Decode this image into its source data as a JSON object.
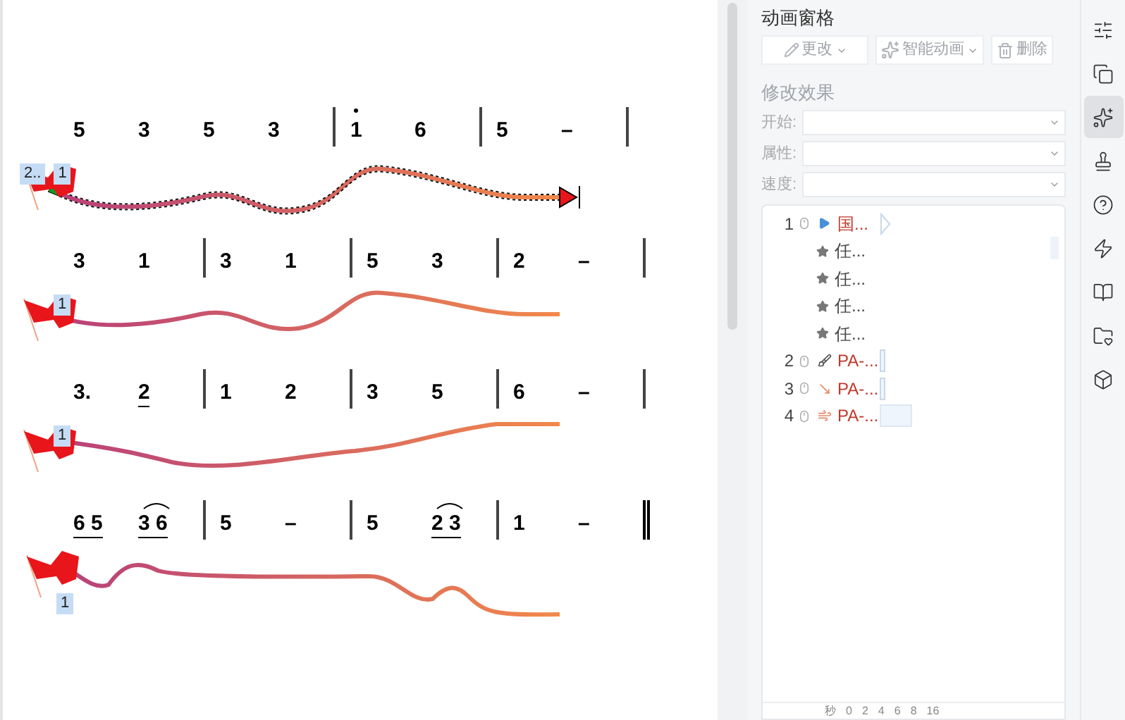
{
  "score": {
    "rows": [
      {
        "selected": true,
        "badges": [
          "2..",
          "1"
        ],
        "measures": [
          {
            "double_bar": false,
            "beats": [
              {
                "text": "5",
                "high": false,
                "underline": false,
                "tie": false
              },
              {
                "text": "3",
                "high": false,
                "underline": false,
                "tie": false
              },
              {
                "text": "5",
                "high": false,
                "underline": false,
                "tie": false
              },
              {
                "text": "3",
                "high": false,
                "underline": false,
                "tie": false
              }
            ]
          },
          {
            "double_bar": false,
            "beats": [
              {
                "text": "1",
                "high": true,
                "underline": false,
                "tie": false
              },
              {
                "text": "6",
                "high": false,
                "underline": false,
                "tie": false
              }
            ]
          },
          {
            "double_bar": false,
            "beats": [
              {
                "text": "5",
                "high": false,
                "underline": false,
                "tie": false
              },
              {
                "text": "–",
                "high": false,
                "underline": false,
                "tie": false
              }
            ]
          }
        ]
      },
      {
        "selected": false,
        "badges": [
          "1"
        ],
        "measures": [
          {
            "double_bar": false,
            "beats": [
              {
                "text": "3",
                "high": false,
                "underline": false,
                "tie": false
              },
              {
                "text": "1",
                "high": false,
                "underline": false,
                "tie": false
              }
            ]
          },
          {
            "double_bar": false,
            "beats": [
              {
                "text": "3",
                "high": false,
                "underline": false,
                "tie": false
              },
              {
                "text": "1",
                "high": false,
                "underline": false,
                "tie": false
              }
            ]
          },
          {
            "double_bar": false,
            "beats": [
              {
                "text": "5",
                "high": false,
                "underline": false,
                "tie": false
              },
              {
                "text": "3",
                "high": false,
                "underline": false,
                "tie": false
              }
            ]
          },
          {
            "double_bar": false,
            "beats": [
              {
                "text": "2",
                "high": false,
                "underline": false,
                "tie": false
              },
              {
                "text": "–",
                "high": false,
                "underline": false,
                "tie": false
              }
            ]
          }
        ]
      },
      {
        "selected": false,
        "badges": [
          "1"
        ],
        "measures": [
          {
            "double_bar": false,
            "beats": [
              {
                "text": "3.",
                "high": false,
                "underline": false,
                "tie": false
              },
              {
                "text": "2",
                "high": false,
                "underline": true,
                "tie": false
              }
            ]
          },
          {
            "double_bar": false,
            "beats": [
              {
                "text": "1",
                "high": false,
                "underline": false,
                "tie": false
              },
              {
                "text": "2",
                "high": false,
                "underline": false,
                "tie": false
              }
            ]
          },
          {
            "double_bar": false,
            "beats": [
              {
                "text": "3",
                "high": false,
                "underline": false,
                "tie": false
              },
              {
                "text": "5",
                "high": false,
                "underline": false,
                "tie": false
              }
            ]
          },
          {
            "double_bar": false,
            "beats": [
              {
                "text": "6",
                "high": false,
                "underline": false,
                "tie": false
              },
              {
                "text": "–",
                "high": false,
                "underline": false,
                "tie": false
              }
            ]
          }
        ]
      },
      {
        "selected": false,
        "badges": [
          "1"
        ],
        "measures": [
          {
            "double_bar": false,
            "beats": [
              {
                "text": "6 5",
                "high": false,
                "underline": true,
                "tie": false
              },
              {
                "text": "3 6",
                "high": false,
                "underline": true,
                "tie": true
              }
            ]
          },
          {
            "double_bar": false,
            "beats": [
              {
                "text": "5",
                "high": false,
                "underline": false,
                "tie": false
              },
              {
                "text": "–",
                "high": false,
                "underline": false,
                "tie": false
              }
            ]
          },
          {
            "double_bar": false,
            "beats": [
              {
                "text": "5",
                "high": false,
                "underline": false,
                "tie": false
              },
              {
                "text": "2 3",
                "high": false,
                "underline": true,
                "tie": true
              }
            ]
          },
          {
            "double_bar": true,
            "beats": [
              {
                "text": "1",
                "high": false,
                "underline": false,
                "tie": false
              },
              {
                "text": "–",
                "high": false,
                "underline": false,
                "tie": false
              }
            ]
          }
        ]
      }
    ]
  },
  "panel": {
    "title": "动画窗格",
    "buttons": [
      {
        "kind": "edit",
        "label": "更改"
      },
      {
        "kind": "smart",
        "label": "智能动画"
      },
      {
        "kind": "delete",
        "label": "删除"
      }
    ],
    "section": "修改效果",
    "fields": [
      {
        "label": "开始:"
      },
      {
        "label": "属性:"
      },
      {
        "label": "速度:"
      }
    ],
    "animations": [
      {
        "number": "1",
        "kind": "play",
        "label": "国...",
        "children": [
          {
            "label": "任..."
          },
          {
            "label": "任..."
          },
          {
            "label": "任..."
          },
          {
            "label": "任..."
          }
        ]
      },
      {
        "number": "2",
        "kind": "brush",
        "label": "PA-..."
      },
      {
        "number": "3",
        "kind": "arrow",
        "label": "PA-..."
      },
      {
        "number": "4",
        "kind": "swirl",
        "label": "PA-..."
      }
    ],
    "ruler": [
      "秒",
      "0",
      "2",
      "4",
      "6",
      "8",
      "16"
    ]
  },
  "sidebar": [
    {
      "kind": "sliders",
      "selected": false
    },
    {
      "kind": "copy",
      "selected": false
    },
    {
      "kind": "star",
      "selected": true
    },
    {
      "kind": "badge",
      "selected": false
    },
    {
      "kind": "help",
      "selected": false
    },
    {
      "kind": "bolt",
      "selected": false
    },
    {
      "kind": "book",
      "selected": false
    },
    {
      "kind": "folder",
      "selected": false
    },
    {
      "kind": "box",
      "selected": false
    }
  ]
}
